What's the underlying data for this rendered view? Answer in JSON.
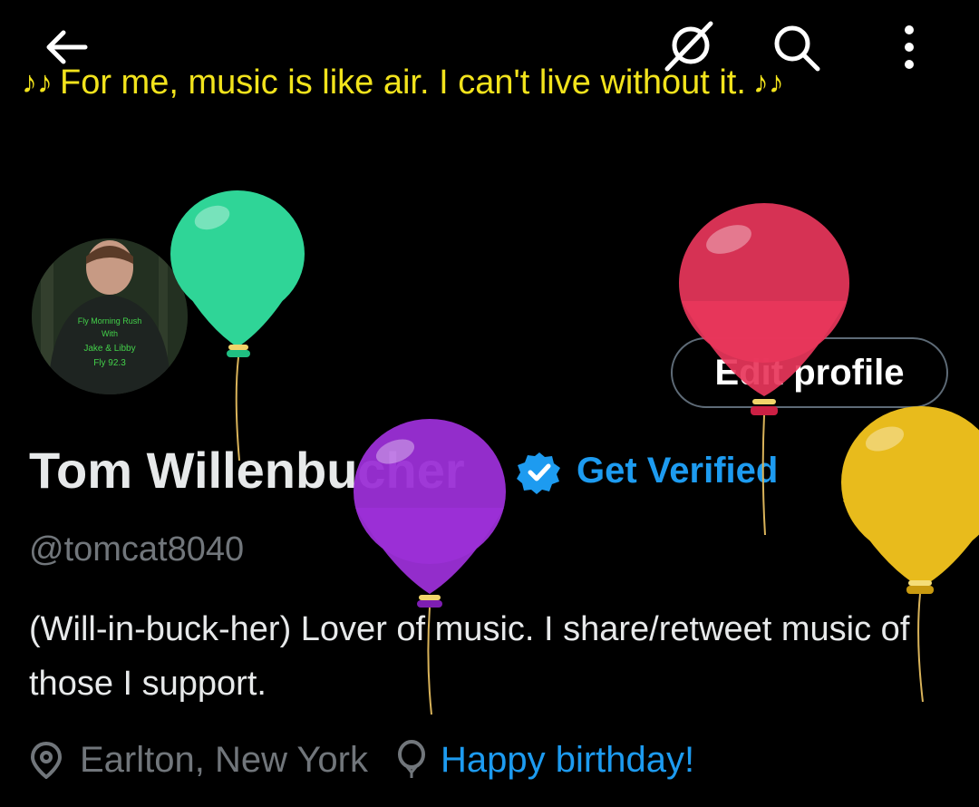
{
  "banner": {
    "note_left": "♪♪",
    "text": "For me, music is like air. I can't live without it.",
    "note_right": "♪♪"
  },
  "header": {
    "back_icon": "arrow-left-icon",
    "grok_icon": "grok-icon",
    "search_icon": "search-icon",
    "more_icon": "more-vertical-icon"
  },
  "profile": {
    "avatar_shirt_text": [
      "Fly Morning Rush",
      "With",
      "Jake & Libby",
      "Fly 92.3"
    ],
    "edit_label": "Edit profile",
    "name": "Tom Willenbucher",
    "get_verified": "Get Verified",
    "handle": "@tomcat8040",
    "bio": "(Will-in-buck-her) Lover of music. I share/retweet music of those I support.",
    "location": "Earlton, New York",
    "birthday": "Happy birthday!"
  },
  "colors": {
    "accent": "#1D9BF0",
    "banner_text": "#F2E31C",
    "text": "#E7E9EA",
    "muted": "#71767B",
    "balloon_green": "#2FD597",
    "balloon_red": "#E8365B",
    "balloon_purple": "#9B2FD6",
    "balloon_yellow": "#E8BB1C"
  }
}
